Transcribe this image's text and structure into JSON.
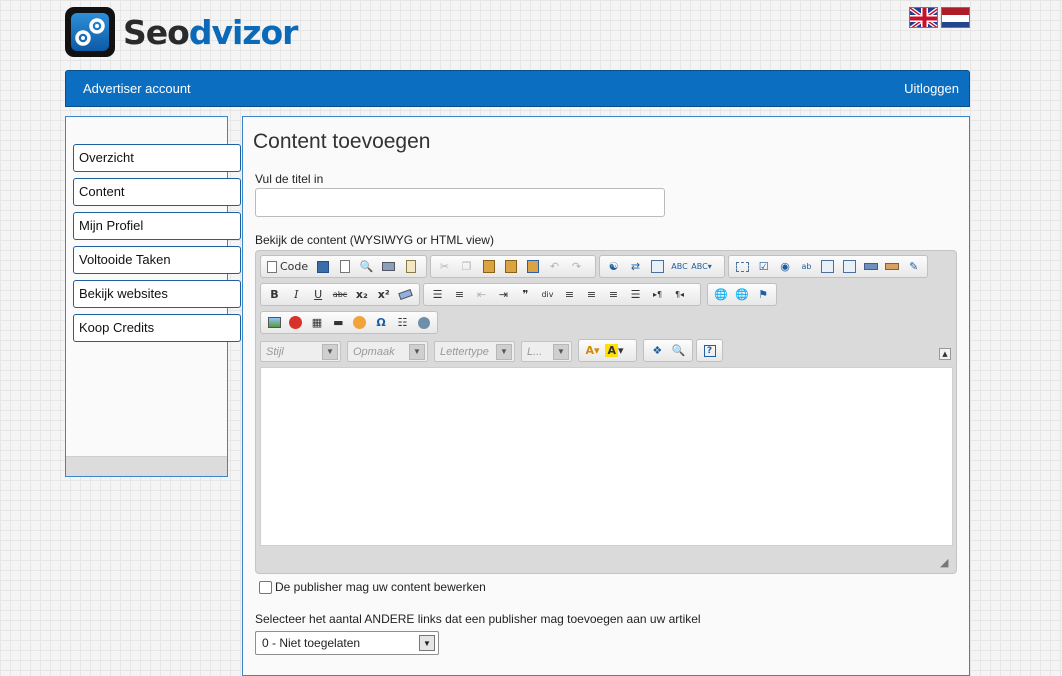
{
  "brand": {
    "part1": "Seo",
    "part2": "dvizor"
  },
  "languages": [
    {
      "name": "English",
      "icon": "uk-flag-icon"
    },
    {
      "name": "Nederlands",
      "icon": "nl-flag-icon"
    }
  ],
  "topnav": {
    "account": "Advertiser account",
    "logout": "Uitloggen"
  },
  "sidebar": {
    "items": [
      {
        "label": "Overzicht"
      },
      {
        "label": "Content"
      },
      {
        "label": "Mijn Profiel"
      },
      {
        "label": "Voltooide Taken"
      },
      {
        "label": "Bekijk websites"
      },
      {
        "label": "Koop Credits"
      }
    ]
  },
  "main": {
    "title": "Content toevoegen",
    "title_label": "Vul de titel in",
    "title_value": "",
    "content_label": "Bekijk de content (WYSIWYG or HTML view)",
    "editor": {
      "code_label": "Code",
      "combos": {
        "style": "Stijl",
        "format": "Opmaak",
        "font": "Lettertype",
        "size": "L..."
      },
      "glyphs": {
        "bold": "B",
        "italic": "I",
        "underline": "U",
        "strike": "abc",
        "sub": "x₂",
        "sup": "x²",
        "quote": "❞",
        "omega": "Ω",
        "help": "?",
        "undo": "↶",
        "redo": "↷",
        "ltr": "▸¶",
        "rtl": "¶◂"
      },
      "icons": [
        "source-icon",
        "save-icon",
        "new-page-icon",
        "preview-icon",
        "print-icon",
        "templates-icon",
        "cut-icon",
        "copy-icon",
        "paste-icon",
        "paste-text-icon",
        "paste-word-icon",
        "undo-icon",
        "redo-icon",
        "find-icon",
        "replace-icon",
        "select-all-icon",
        "spellcheck-icon",
        "scayt-icon",
        "form-icon",
        "checkbox-icon",
        "radio-icon",
        "textfield-icon",
        "textarea-icon",
        "select-icon",
        "button-icon",
        "imagebutton-icon",
        "hiddenfield-icon",
        "bold-icon",
        "italic-icon",
        "underline-icon",
        "strike-icon",
        "subscript-icon",
        "superscript-icon",
        "remove-format-icon",
        "numbered-list-icon",
        "bulleted-list-icon",
        "outdent-icon",
        "indent-icon",
        "blockquote-icon",
        "div-icon",
        "align-left-icon",
        "align-center-icon",
        "align-right-icon",
        "justify-icon",
        "ltr-icon",
        "rtl-icon",
        "link-icon",
        "unlink-icon",
        "anchor-icon",
        "image-icon",
        "flash-icon",
        "table-icon",
        "horizontal-rule-icon",
        "smiley-icon",
        "special-char-icon",
        "pagebreak-icon",
        "iframe-icon",
        "text-color-icon",
        "bg-color-icon",
        "maximize-icon",
        "show-blocks-icon",
        "about-icon"
      ]
    },
    "checkbox_label": "De publisher mag uw content bewerken",
    "checkbox_checked": false,
    "links_label": "Selecteer het aantal ANDERE links dat een publisher mag toevoegen aan uw artikel",
    "links_selected": "0 - Niet toegelaten"
  },
  "colors": {
    "nav": "#0b6ec1",
    "border": "#3a86c8",
    "brand_blue": "#0a6ab8"
  }
}
